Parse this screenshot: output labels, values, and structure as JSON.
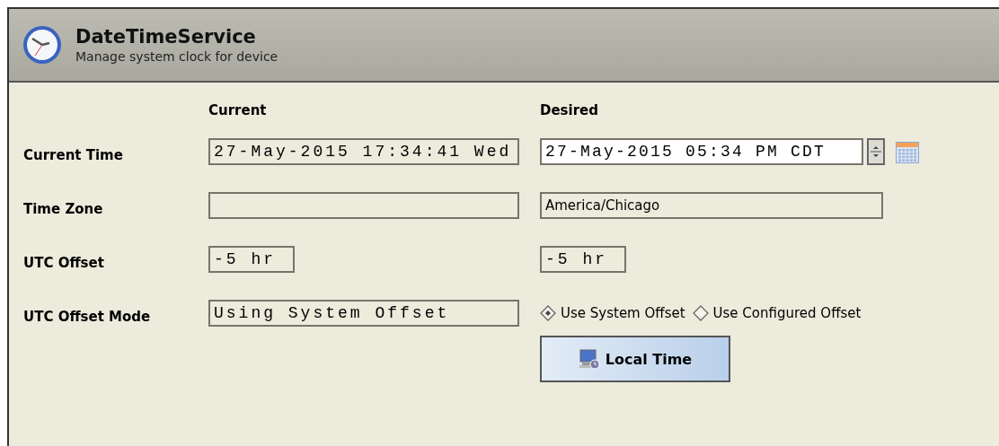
{
  "header": {
    "title": "DateTimeService",
    "subtitle": "Manage system clock for device"
  },
  "columns": {
    "current": "Current",
    "desired": "Desired"
  },
  "rows": [
    {
      "kind": "datetime",
      "label": "Current Time",
      "current": "27-May-2015 17:34:41 Wed",
      "desired": "27-May-2015 05:34 PM CDT"
    },
    {
      "kind": "text",
      "label": "Time Zone",
      "desired": "America/Chicago"
    },
    {
      "kind": "short",
      "label": "UTC Offset",
      "current": "-5 hr",
      "desired": "-5 hr"
    },
    {
      "kind": "radio",
      "label": "UTC Offset Mode",
      "current": "Using System Offset",
      "options": [
        {
          "label": "Use System Offset",
          "selected": true
        },
        {
          "label": "Use Configured Offset",
          "selected": false
        }
      ]
    }
  ],
  "button": {
    "label": "Local Time"
  }
}
